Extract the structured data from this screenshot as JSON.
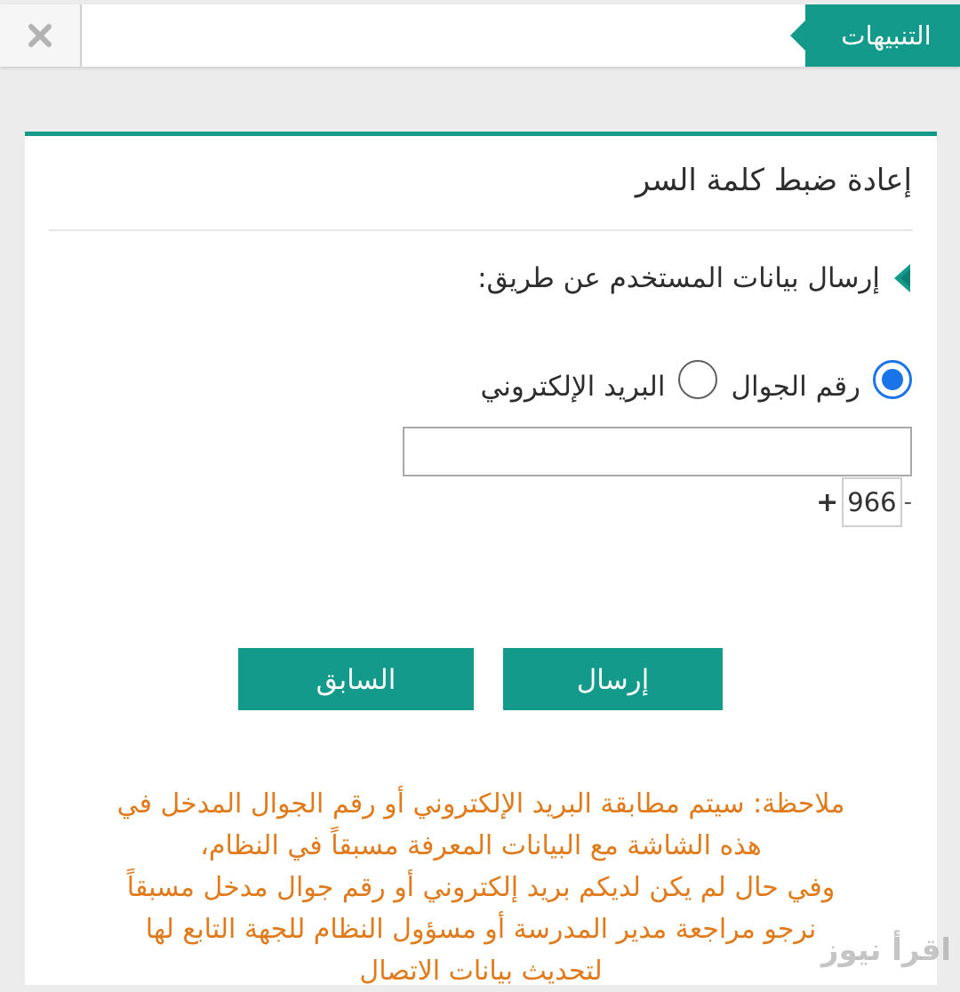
{
  "notifications": {
    "tab_label": "التنبيهات",
    "close_icon": "close-icon"
  },
  "card": {
    "title": "إعادة ضبط كلمة السر",
    "section_heading": "إرسال بيانات المستخدم عن طريق:",
    "radios": [
      {
        "label": "رقم الجوال",
        "checked": true
      },
      {
        "label": "البريد الإلكتروني",
        "checked": false
      }
    ],
    "phone_input": {
      "value": "",
      "placeholder": ""
    },
    "prefix": {
      "plus": "+",
      "code": "966",
      "dash": "-"
    },
    "buttons": {
      "send": "إرسال",
      "previous": "السابق"
    },
    "note": {
      "line1": "ملاحظة: سيتم مطابقة البريد الإلكتروني أو رقم الجوال المدخل في",
      "line2": "هذه الشاشة مع البيانات المعرفة مسبقاً في النظام،",
      "line3": "وفي حال لم يكن لديكم بريد إلكتروني أو رقم جوال مدخل مسبقاً",
      "line4": "نرجو مراجعة مدير المدرسة أو مسؤول النظام للجهة التابع لها",
      "line5": "لتحديث بيانات الاتصال"
    }
  },
  "watermark": "اقرأ نيوز",
  "colors": {
    "accent": "#139a8b",
    "radio_selected": "#1a73e8",
    "note": "#e07a1b"
  }
}
